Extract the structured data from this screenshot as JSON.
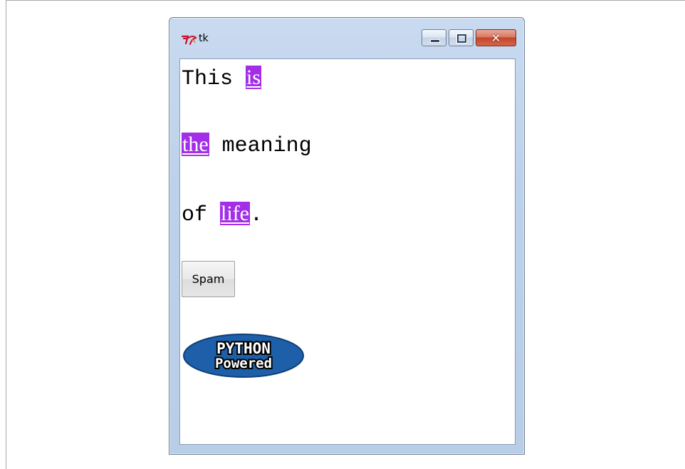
{
  "window": {
    "title": "tk",
    "buttons": {
      "minimize": "minimize",
      "maximize": "maximize",
      "close": "close"
    }
  },
  "content": {
    "line1": {
      "pre": "This ",
      "tag": "is"
    },
    "line2": {
      "tag": "the",
      "post": " meaning"
    },
    "line3": {
      "pre": "of ",
      "tag": "life",
      "post": "."
    },
    "highlight_color": "#a22ee8",
    "button_label": "Spam",
    "logo": {
      "line1": "PYTHON",
      "line2": "Powered"
    }
  },
  "icons": [
    "tk-feather-icon",
    "minimize-icon",
    "maximize-icon",
    "close-icon"
  ]
}
